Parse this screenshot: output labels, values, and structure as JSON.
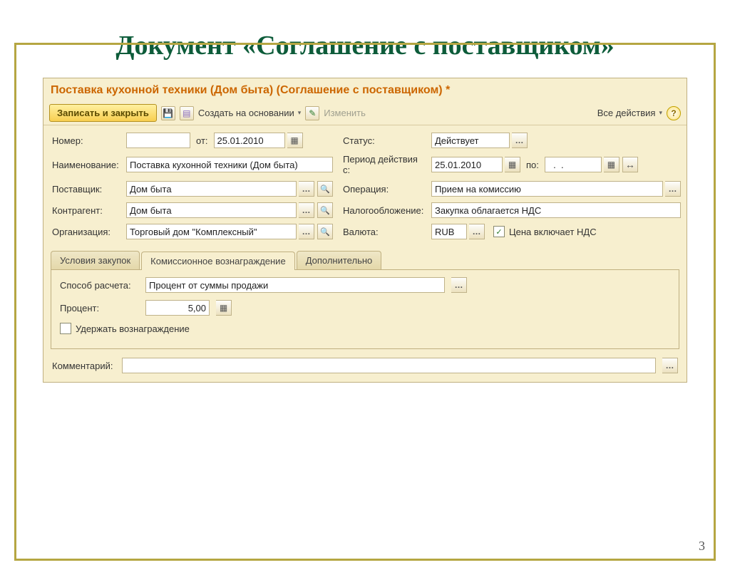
{
  "slide": {
    "title": "Документ «Соглашение с поставщиком»",
    "page_number": "3"
  },
  "window": {
    "title": "Поставка кухонной техники (Дом быта) (Соглашение с поставщиком) *"
  },
  "toolbar": {
    "save_close": "Записать и закрыть",
    "create_based": "Создать на основании",
    "change": "Изменить",
    "all_actions": "Все действия"
  },
  "fields": {
    "number_label": "Номер:",
    "number_value": "",
    "date_prefix": "от:",
    "date_value": "25.01.2010",
    "status_label": "Статус:",
    "status_value": "Действует",
    "name_label": "Наименование:",
    "name_value": "Поставка кухонной техники (Дом быта)",
    "period_label": "Период действия с:",
    "period_from": "25.01.2010",
    "period_to_prefix": "по:",
    "period_to": "  .  .",
    "supplier_label": "Поставщик:",
    "supplier_value": "Дом быта",
    "operation_label": "Операция:",
    "operation_value": "Прием на комиссию",
    "counterparty_label": "Контрагент:",
    "counterparty_value": "Дом быта",
    "tax_label": "Налогообложение:",
    "tax_value": "Закупка облагается НДС",
    "org_label": "Организация:",
    "org_value": "Торговый дом \"Комплексный\"",
    "currency_label": "Валюта:",
    "currency_value": "RUB",
    "vat_included_label": "Цена включает НДС",
    "vat_included_checked": "✓"
  },
  "tabs": {
    "t1": "Условия закупок",
    "t2": "Комиссионное вознаграждение",
    "t3": "Дополнительно"
  },
  "commission": {
    "method_label": "Способ расчета:",
    "method_value": "Процент от суммы продажи",
    "percent_label": "Процент:",
    "percent_value": "5,00",
    "withhold_label": "Удержать вознаграждение"
  },
  "comment": {
    "label": "Комментарий:",
    "value": ""
  }
}
